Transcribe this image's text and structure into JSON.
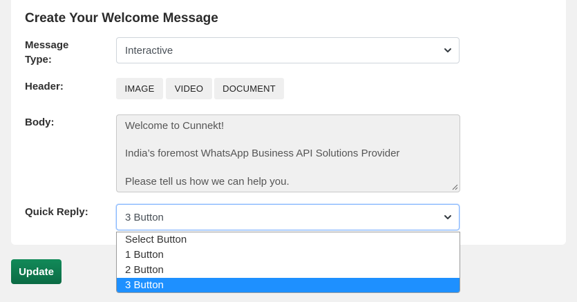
{
  "form": {
    "title": "Create Your Welcome Message",
    "message_type_label": "Message",
    "message_type_label_2": "Type:",
    "message_type_value": "Interactive",
    "header_label": "Header:",
    "header_buttons": [
      "IMAGE",
      "VIDEO",
      "DOCUMENT"
    ],
    "body_label": "Body:",
    "body_lines": [
      "Welcome to Cunnekt!",
      "India’s foremost WhatsApp Business API Solutions Provider",
      "Please tell us how we can help you."
    ],
    "quick_reply_label": "Quick Reply:",
    "quick_reply_value": "3 Button",
    "quick_reply_options": [
      "Select Button",
      "1 Button",
      "2 Button",
      "3 Button"
    ],
    "quick_reply_selected_index": 3,
    "update_label": "Update"
  },
  "colors": {
    "accent_green": "#0f7a4f",
    "selected_option": "#1e90ff",
    "focus_border": "#86b7fe"
  },
  "icons": {
    "select_arrow": "chevron-down-icon",
    "textarea_resize": "resize-grip-icon"
  }
}
